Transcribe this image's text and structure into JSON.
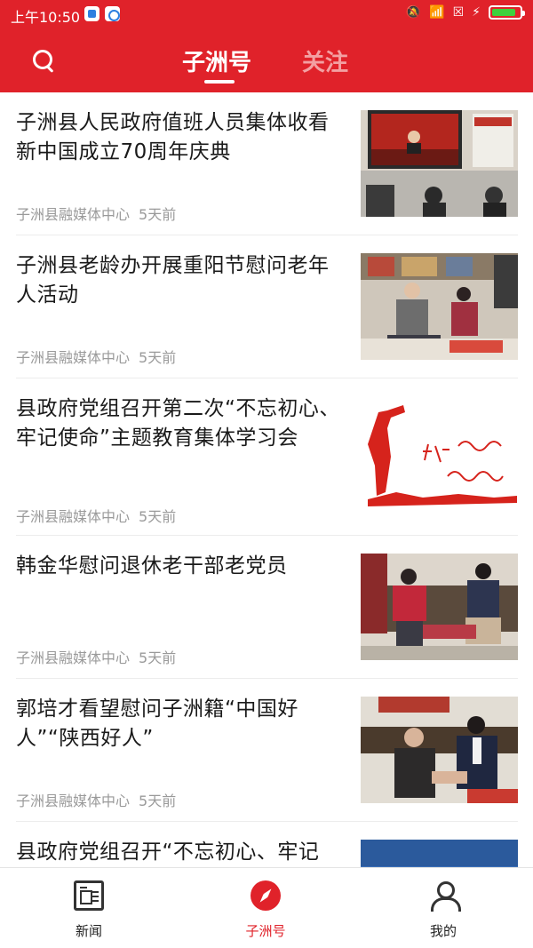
{
  "status_bar": {
    "time": "上午10:50",
    "icons": [
      "app-notification-icon",
      "app-notification-icon",
      "mute-icon",
      "wifi-icon",
      "sim-icon",
      "charging-icon",
      "battery-icon"
    ],
    "battery_level": 0.85
  },
  "header": {
    "search_icon": "search-icon",
    "tabs": [
      {
        "label": "子洲号",
        "active": true
      },
      {
        "label": "关注",
        "active": false
      }
    ]
  },
  "feed": {
    "items": [
      {
        "title": "子洲县人民政府值班人员集体收看新中国成立70周年庆典",
        "source": "子洲县融媒体中心",
        "age": "5天前"
      },
      {
        "title": "子洲县老龄办开展重阳节慰问老年人活动",
        "source": "子洲县融媒体中心",
        "age": "5天前"
      },
      {
        "title": "县政府党组召开第二次“不忘初心、牢记使命”主题教育集体学习会",
        "source": "子洲县融媒体中心",
        "age": "5天前"
      },
      {
        "title": "韩金华慰问退休老干部老党员",
        "source": "子洲县融媒体中心",
        "age": "5天前"
      },
      {
        "title": "郭培才看望慰问子洲籍“中国好人”“陕西好人”",
        "source": "子洲县融媒体中心",
        "age": "5天前"
      },
      {
        "title": "县政府党组召开“不忘初心、牢记",
        "source": "",
        "age": ""
      }
    ]
  },
  "bottom_nav": {
    "items": [
      {
        "label": "新闻",
        "icon": "newspaper-icon",
        "active": false
      },
      {
        "label": "子洲号",
        "icon": "compass-icon",
        "active": true
      },
      {
        "label": "我的",
        "icon": "user-icon",
        "active": false
      }
    ]
  },
  "colors": {
    "brand_red": "#e0222a",
    "inactive_tab": "#f3a0a2",
    "meta_gray": "#9a9a9a"
  }
}
